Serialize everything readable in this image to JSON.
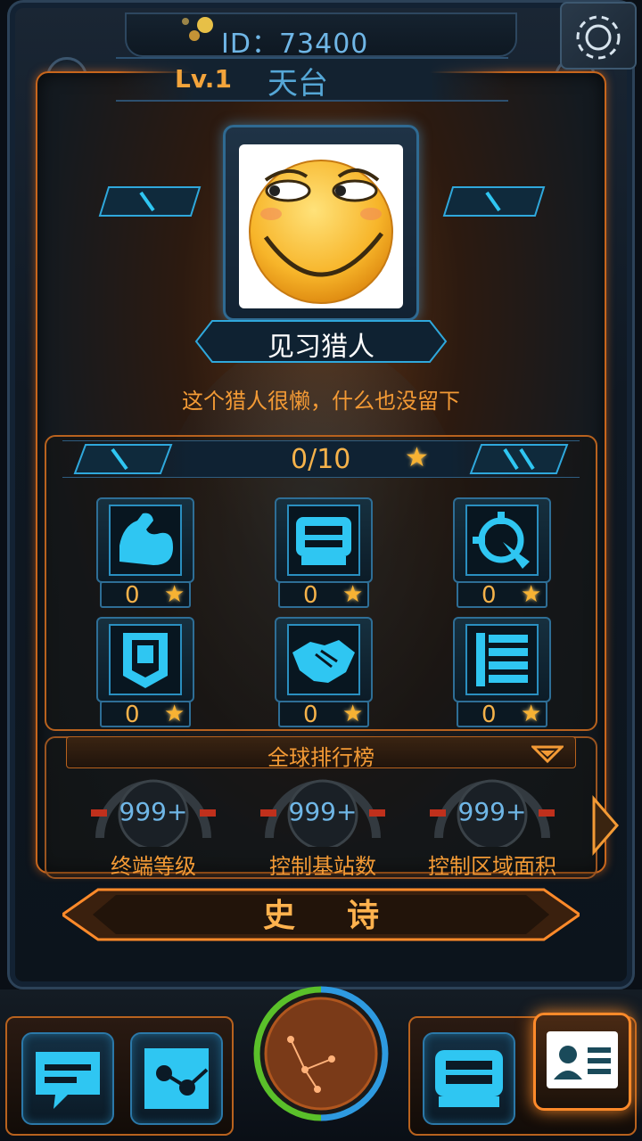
{
  "header": {
    "id_text": "ID：73400",
    "level": "Lv.1",
    "area_name": "天台"
  },
  "profile": {
    "nickname": "见习猎人",
    "signature": "这个猎人很懒，什么也没留下"
  },
  "stars": {
    "progress_text": "0/10",
    "progress_value": 0,
    "progress_max": 10,
    "tiles": [
      {
        "icon": "muscle-arm-icon",
        "count": "0"
      },
      {
        "icon": "terminal-device-icon",
        "count": "0"
      },
      {
        "icon": "crosshair-target-icon",
        "count": "0"
      },
      {
        "icon": "banner-shield-icon",
        "count": "0"
      },
      {
        "icon": "handshake-icon",
        "count": "0"
      },
      {
        "icon": "list-rows-icon",
        "count": "0"
      }
    ]
  },
  "ranking": {
    "title": "全球排行榜",
    "items": [
      {
        "value": "999+",
        "label": "终端等级"
      },
      {
        "value": "999+",
        "label": "控制基站数"
      },
      {
        "value": "999+",
        "label": "控制区域面积"
      }
    ]
  },
  "rank_tier": "史诗",
  "bottom_nav": [
    {
      "icon": "chat-bubble-icon",
      "name": "chat"
    },
    {
      "icon": "network-nodes-icon",
      "name": "network"
    },
    {
      "icon": "globe-radar-icon",
      "name": "globe"
    },
    {
      "icon": "terminal-device-icon",
      "name": "terminal"
    },
    {
      "icon": "id-card-icon",
      "name": "profile"
    }
  ],
  "colors": {
    "accent_orange": "#f39a35",
    "accent_blue": "#2fc6f2",
    "star_gold": "#f7b233"
  }
}
